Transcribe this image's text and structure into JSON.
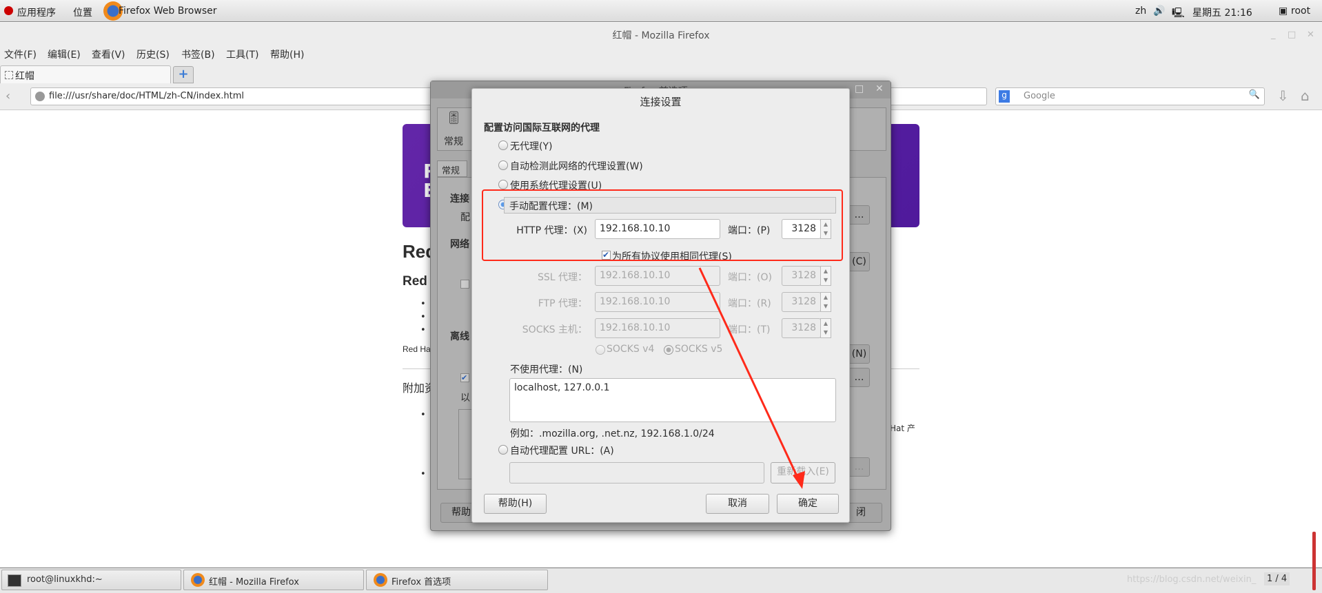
{
  "top_panel": {
    "apps": "应用程序",
    "places": "位置",
    "active_app": "Firefox Web Browser",
    "lang": "zh",
    "clock": "星期五 21:16",
    "user": "root"
  },
  "window": {
    "title": "红帽 - Mozilla Firefox"
  },
  "menu": [
    "文件(F)",
    "编辑(E)",
    "查看(V)",
    "历史(S)",
    "书签(B)",
    "工具(T)",
    "帮助(H)"
  ],
  "tabs": [
    {
      "label": "红帽"
    }
  ],
  "nav": {
    "url": "file:///usr/share/doc/HTML/zh-CN/index.html",
    "search_placeholder": "Google"
  },
  "page": {
    "banner_letters": "R\nE",
    "heading": "Red",
    "subheading": "Red",
    "footnote": "Red Ha",
    "extra": "附加资",
    "right_text": "Hat 产"
  },
  "prefs": {
    "title": "Firefox 首选项",
    "toolbar_item": "常规",
    "tab": "常规",
    "sections": [
      "连接",
      "配",
      "网络",
      "离线"
    ],
    "sub": "以",
    "help": "帮助",
    "right_btn_labels": [
      "…",
      "(C)",
      "(N)",
      "…",
      "…"
    ],
    "close": "闭"
  },
  "dialog": {
    "title": "连接设置",
    "heading": "配置访问国际互联网的代理",
    "options": [
      "无代理(Y)",
      "自动检测此网络的代理设置(W)",
      "使用系统代理设置(U)",
      "手动配置代理：(M)"
    ],
    "selected_option": 3,
    "rows": [
      {
        "label": "HTTP 代理：(X)",
        "host": "192.168.10.10",
        "port_label": "端口：(P)",
        "port": "3128",
        "enabled": true
      },
      {
        "label": "SSL 代理：",
        "host": "192.168.10.10",
        "port_label": "端口：(O)",
        "port": "3128",
        "enabled": false
      },
      {
        "label": "FTP 代理：",
        "host": "192.168.10.10",
        "port_label": "端口：(R)",
        "port": "3128",
        "enabled": false
      },
      {
        "label": "SOCKS 主机：",
        "host": "192.168.10.10",
        "port_label": "端口：(T)",
        "port": "3128",
        "enabled": false
      }
    ],
    "same_proxy": {
      "label": "为所有协议使用相同代理(S)",
      "checked": true
    },
    "socks_v4": "SOCKS v4",
    "socks_v5": "SOCKS v5",
    "socks_selected": "v5",
    "no_proxy_label": "不使用代理：(N)",
    "no_proxy_value": "localhost, 127.0.0.1",
    "example": "例如：.mozilla.org, .net.nz, 192.168.1.0/24",
    "auto_url_label": "自动代理配置 URL：(A)",
    "auto_url_value": "",
    "reload": "重新载入(E)",
    "help": "帮助(H)",
    "cancel": "取消",
    "ok": "确定"
  },
  "annotation_color": "#ff2a1a",
  "taskbar": {
    "items": [
      "root@linuxkhd:~",
      "红帽 - Mozilla Firefox",
      "Firefox 首选项"
    ],
    "workspace": "1 / 4",
    "watermark": "https://blog.csdn.net/weixin_"
  }
}
